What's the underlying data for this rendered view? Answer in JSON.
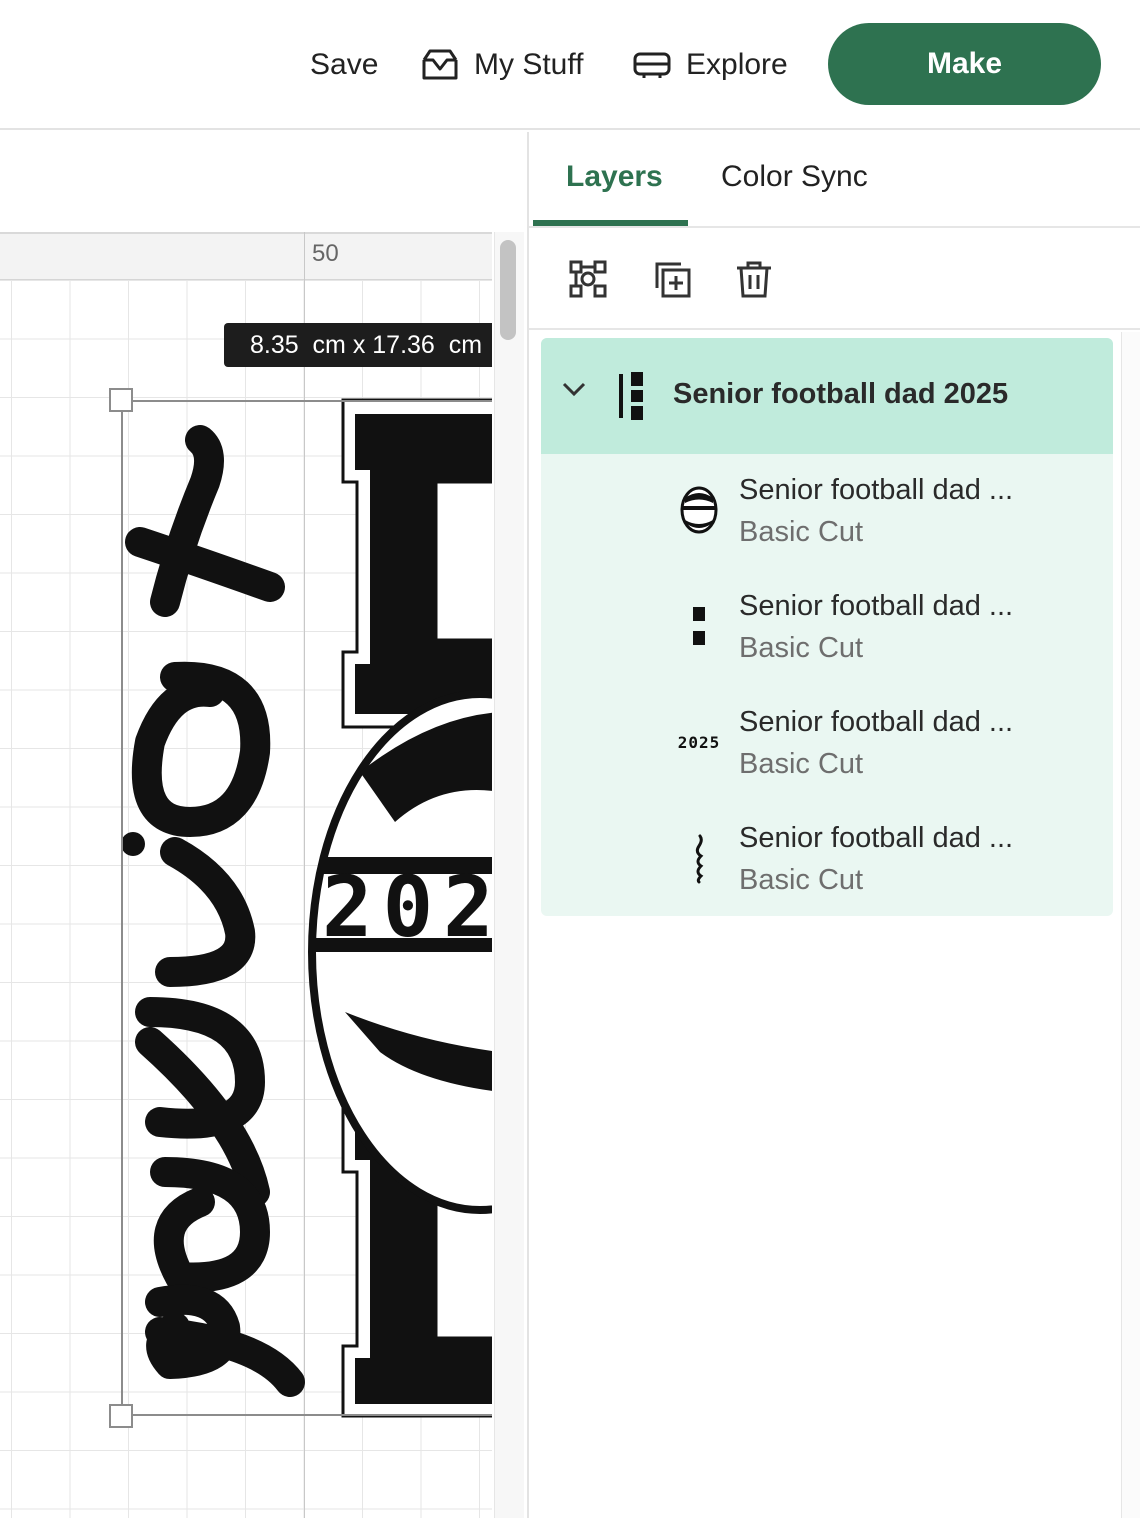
{
  "header": {
    "save_label": "Save",
    "my_stuff_label": "My Stuff",
    "explore_label": "Explore",
    "make_label": "Make"
  },
  "canvas": {
    "ruler_label": "50",
    "dimension_badge": "8.35  cm x 17.36  cm",
    "design_script_text": "senior",
    "design_year_text": "202"
  },
  "panel": {
    "tabs": [
      {
        "label": "Layers",
        "active": true
      },
      {
        "label": "Color Sync",
        "active": false
      }
    ],
    "toolbar": [
      "group-icon",
      "duplicate-icon",
      "delete-icon"
    ],
    "group": {
      "title": "Senior football dad 2025",
      "expanded": true
    },
    "layers": [
      {
        "name": "Senior football dad ...",
        "type": "Basic Cut",
        "thumb": "football-thumb"
      },
      {
        "name": "Senior football dad ...",
        "type": "Basic Cut",
        "thumb": "letters-thumb"
      },
      {
        "name": "Senior football dad ...",
        "type": "Basic Cut",
        "thumb": "2025"
      },
      {
        "name": "Senior football dad ...",
        "type": "Basic Cut",
        "thumb": "script-thumb"
      }
    ]
  },
  "colors": {
    "accent": "#2e7250",
    "group_highlight": "#c0ebdc",
    "layer_background": "#eaf7f2"
  }
}
